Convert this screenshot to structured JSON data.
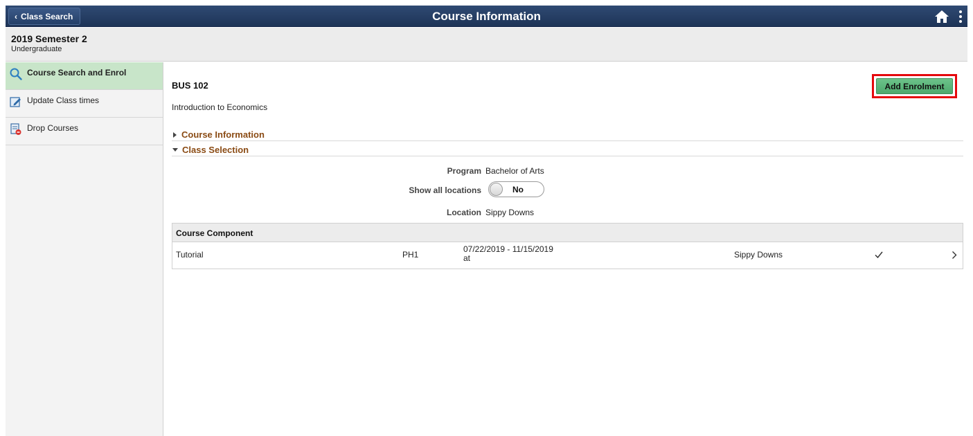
{
  "header": {
    "back_label": "Class Search",
    "title": "Course Information",
    "icons": {
      "back": "chevron-left-icon",
      "home": "home-icon",
      "menu": "kebab-menu-icon"
    }
  },
  "term": {
    "title": "2019 Semester 2",
    "career": "Undergraduate"
  },
  "sidebar": {
    "items": [
      {
        "label": "Course Search and Enrol",
        "icon": "search-icon",
        "active": true
      },
      {
        "label": "Update Class times",
        "icon": "edit-icon",
        "active": false
      },
      {
        "label": "Drop Courses",
        "icon": "drop-icon",
        "active": false
      }
    ]
  },
  "course": {
    "code": "BUS 102",
    "description": "Introduction to Economics"
  },
  "actions": {
    "add_enrolment": "Add Enrolment"
  },
  "sections": {
    "course_info": "Course Information",
    "class_selection": "Class Selection"
  },
  "fields": {
    "program_label": "Program",
    "program_value": "Bachelor of Arts",
    "show_all_label": "Show all locations",
    "show_all_value": "No",
    "location_label": "Location",
    "location_value": "Sippy Downs"
  },
  "component_table": {
    "header": "Course Component",
    "rows": [
      {
        "component": "Tutorial",
        "section": "PH1",
        "dates": "07/22/2019 - 11/15/2019",
        "time": "at",
        "location": "Sippy Downs",
        "status_icon": "checkmark-icon",
        "nav_icon": "chevron-right-icon"
      }
    ]
  },
  "colors": {
    "header_bg": "#1e3457",
    "active_nav_bg": "#c8e5c9",
    "section_title": "#8a4b14",
    "primary_button": "#5bb57b",
    "highlight_border": "#e5090d"
  }
}
